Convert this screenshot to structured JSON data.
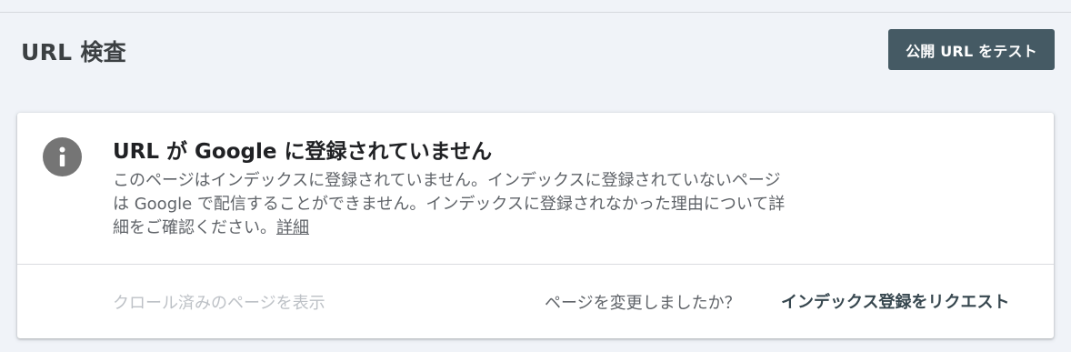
{
  "header": {
    "title": "URL 検査",
    "test_live_url_button": "公開 URL をテスト"
  },
  "status_card": {
    "icon": "info-icon",
    "title": "URL が Google に登録されていません",
    "description": "このページはインデックスに登録されていません。インデックスに登録されていないページは Google で配信することができません。インデックスに登録されなかった理由について詳細をご確認ください。",
    "details_link": "詳細",
    "view_crawled_page": "クロール済みのページを表示",
    "page_changed_question": "ページを変更しましたか？",
    "request_indexing": "インデックス登録をリクエスト"
  },
  "colors": {
    "page_background": "#f0f3f8",
    "primary_button": "#455a64",
    "icon_gray": "#757575",
    "disabled_text": "#bdc1c6"
  }
}
